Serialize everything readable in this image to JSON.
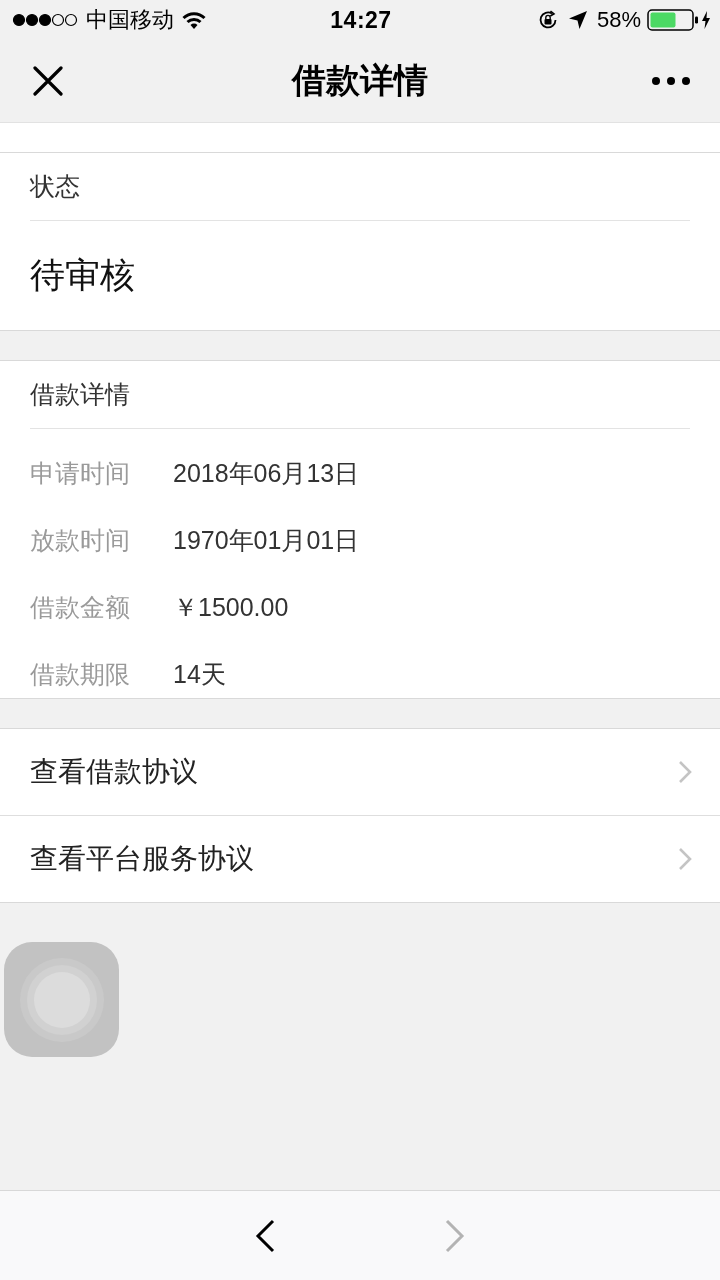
{
  "status_bar": {
    "carrier": "中国移动",
    "time": "14:27",
    "battery": "58%"
  },
  "nav_bar": {
    "title": "借款详情"
  },
  "status_card": {
    "label": "状态",
    "value": "待审核"
  },
  "details_card": {
    "title": "借款详情",
    "rows": [
      {
        "label": "申请时间",
        "value": "2018年06月13日"
      },
      {
        "label": "放款时间",
        "value": "1970年01月01日"
      },
      {
        "label": "借款金额",
        "value": "￥1500.00"
      },
      {
        "label": "借款期限",
        "value": "14天"
      }
    ]
  },
  "links": [
    {
      "label": "查看借款协议"
    },
    {
      "label": "查看平台服务协议"
    }
  ],
  "toolbar": {
    "back": {
      "disabled": false
    },
    "forward": {
      "disabled": true
    }
  }
}
